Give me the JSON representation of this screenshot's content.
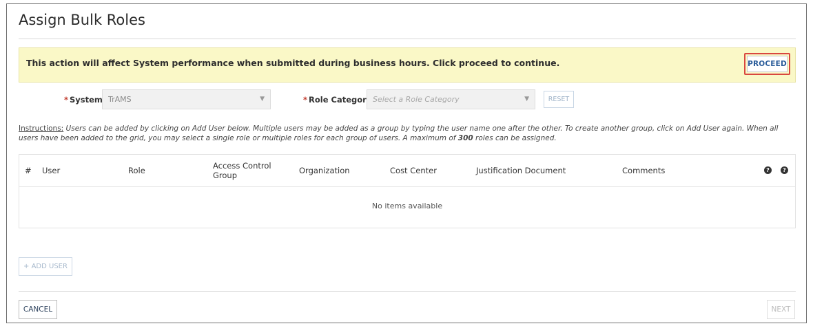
{
  "page": {
    "title": "Assign Bulk Roles"
  },
  "banner": {
    "message": "This action will affect System performance when submitted during business hours. Click proceed to continue.",
    "proceed_label": "PROCEED",
    "highlight_color": "#d9473f"
  },
  "filters": {
    "required_marker": "*",
    "system": {
      "label": "System",
      "value": "TrAMS"
    },
    "role_category": {
      "label": "Role Category",
      "placeholder": "Select a Role Category"
    },
    "reset_label": "RESET"
  },
  "instructions": {
    "lead": "Instructions:",
    "text_before": " Users can be added by clicking on Add User below. Multiple users may be added as a group by typing the user name one after the other. To create another group, click on Add User again. When all users have been added to the grid, you may select a single role or multiple roles for each group of users. A maximum of ",
    "max_roles": "300",
    "text_after": " roles can be assigned."
  },
  "grid": {
    "columns": [
      "#",
      "User",
      "Role",
      "Access Control Group",
      "Organization",
      "Cost Center",
      "Justification Document",
      "Comments"
    ],
    "help_icon_glyph": "?",
    "empty_message": "No items available"
  },
  "actions": {
    "add_user_label": "+ ADD USER",
    "cancel_label": "CANCEL",
    "next_label": "NEXT"
  }
}
